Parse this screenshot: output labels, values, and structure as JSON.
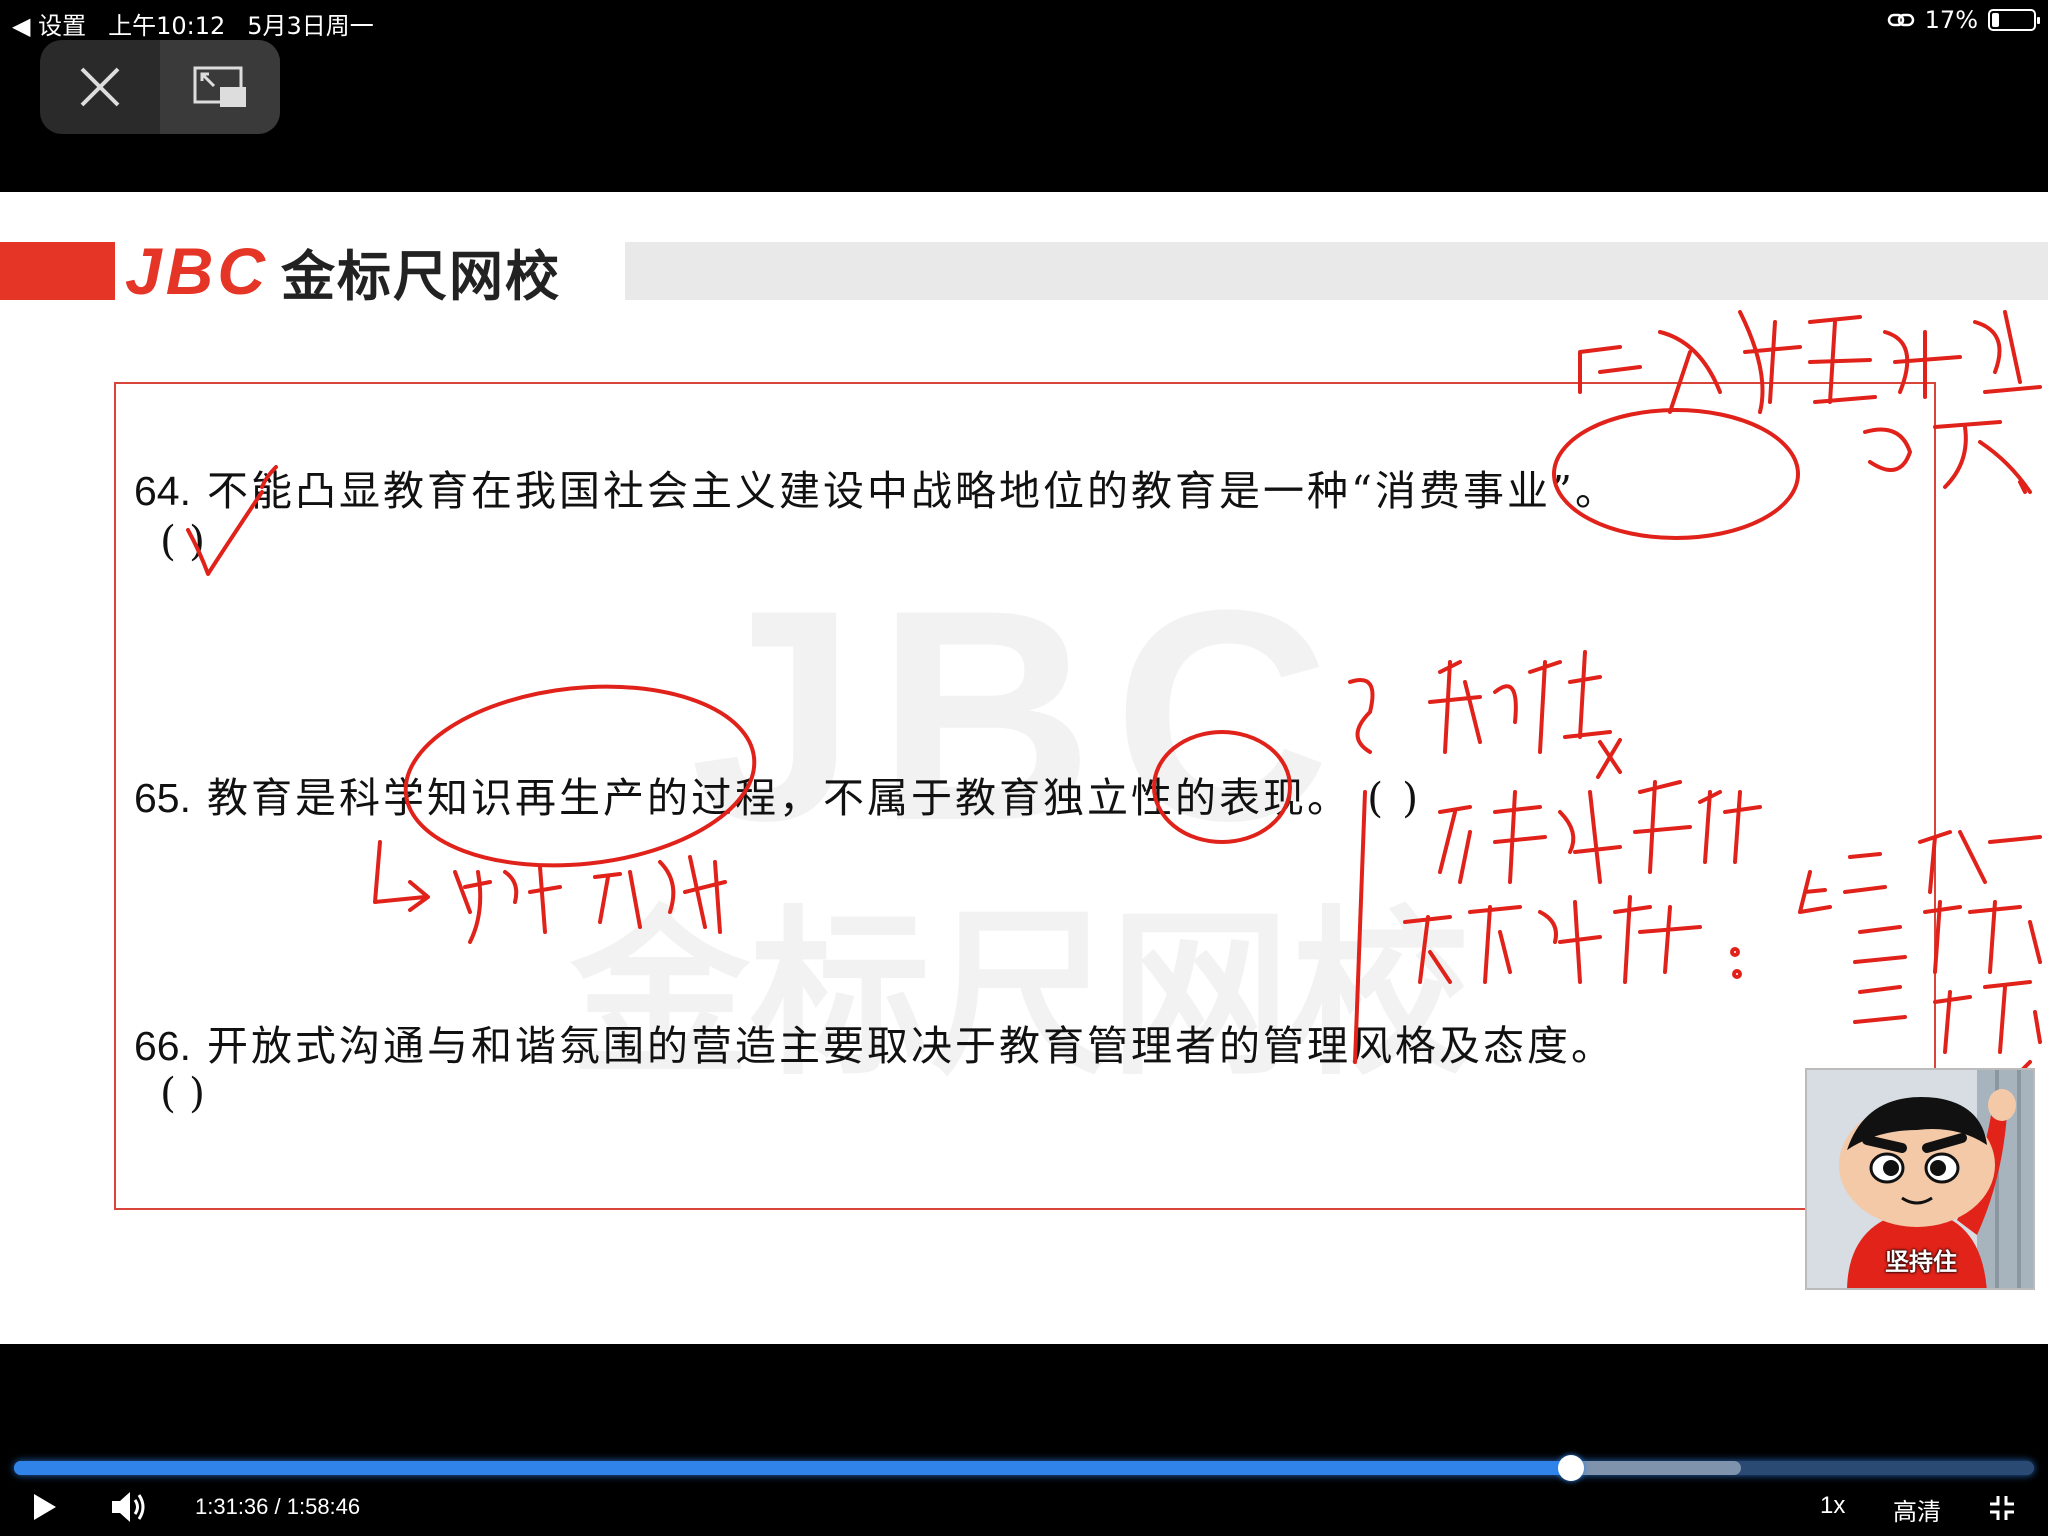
{
  "status_bar": {
    "back_label": "◀ 设置",
    "time": "上午10:12",
    "date": "5月3日周一",
    "battery_percent": "17%",
    "battery_level": 0.17
  },
  "brand": {
    "logo_latin": "JBC",
    "logo_cn": "金标尺网校"
  },
  "questions": [
    {
      "number": "64.",
      "text": "不能凸显教育在我国社会主义建设中战略地位的教育是一种“消费事业”。",
      "answer": "(    )"
    },
    {
      "number": "65.",
      "text": "教育是科学知识再生产的过程，不属于教育独立性的表现。",
      "answer": "(    )"
    },
    {
      "number": "66.",
      "text": "开放式沟通与和谐氛围的营造主要取决于教育管理者的管理风格及态度。",
      "answer": "(    )"
    }
  ],
  "sticker": {
    "caption": "坚持住"
  },
  "player": {
    "current_time": "1:31:36",
    "duration": "1:58:46",
    "time_display": "1:31:36 / 1:58:46",
    "progress_fraction": 0.771,
    "buffered_fraction": 0.855,
    "speed": "1x",
    "quality": "高清"
  },
  "colors": {
    "accent_progress": "#2f83e9",
    "brand_red": "#e53526",
    "annotation_red": "#e0221a"
  }
}
